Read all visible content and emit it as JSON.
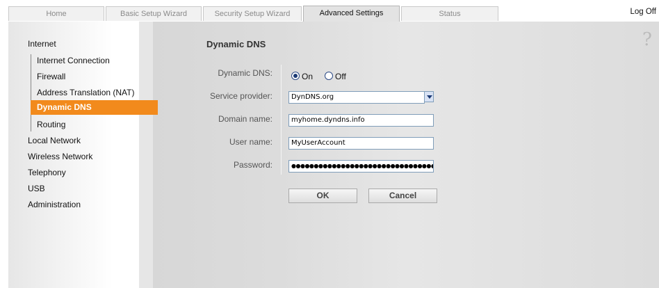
{
  "nav": {
    "tabs": [
      {
        "label": "Home"
      },
      {
        "label": "Basic Setup Wizard"
      },
      {
        "label": "Security Setup Wizard"
      },
      {
        "label": "Advanced Settings"
      },
      {
        "label": "Status"
      }
    ],
    "active_tab": "Advanced Settings",
    "logoff_label": "Log Off"
  },
  "sidebar": {
    "items": [
      {
        "label": "Internet"
      },
      {
        "label": "Internet Connection"
      },
      {
        "label": "Firewall"
      },
      {
        "label": "Address Translation (NAT)"
      },
      {
        "label": "Dynamic DNS"
      },
      {
        "label": "Routing"
      },
      {
        "label": "Local Network"
      },
      {
        "label": "Wireless Network"
      },
      {
        "label": "Telephony"
      },
      {
        "label": "USB"
      },
      {
        "label": "Administration"
      }
    ],
    "active_item": "Dynamic DNS"
  },
  "page": {
    "title": "Dynamic DNS",
    "help_glyph": "?"
  },
  "form": {
    "dynamic_dns": {
      "label": "Dynamic DNS:",
      "on_label": "On",
      "off_label": "Off",
      "selected": "On"
    },
    "service_provider": {
      "label": "Service provider:",
      "value": "DynDNS.org"
    },
    "domain_name": {
      "label": "Domain name:",
      "value": "myhome.dyndns.info"
    },
    "user_name": {
      "label": "User name:",
      "value": "MyUserAccount"
    },
    "password": {
      "label": "Password:",
      "value": "●●●●●●●●●●●●●●●●●●●●●●●●●●●●●●●●●"
    }
  },
  "buttons": {
    "ok": "OK",
    "cancel": "Cancel"
  },
  "colors": {
    "accent": "#f28a1c",
    "panel": "#d9d9d9",
    "radio": "#1b3a74"
  }
}
